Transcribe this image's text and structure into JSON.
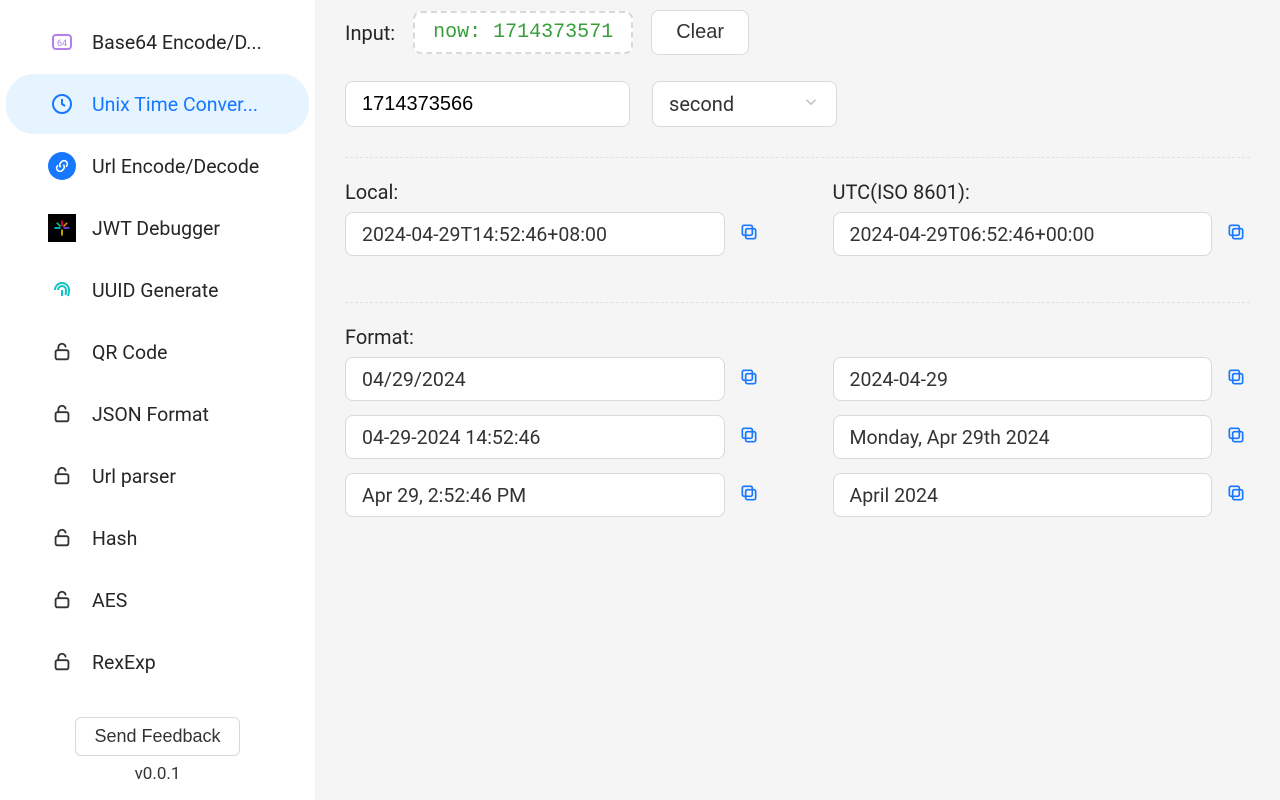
{
  "sidebar": {
    "items": [
      {
        "label": "Base64 Encode/D...",
        "icon": "base64-icon"
      },
      {
        "label": "Unix Time Conver...",
        "icon": "clock-icon"
      },
      {
        "label": "Url Encode/Decode",
        "icon": "link-icon"
      },
      {
        "label": "JWT Debugger",
        "icon": "jwt-icon"
      },
      {
        "label": "UUID Generate",
        "icon": "fingerprint-icon"
      },
      {
        "label": "QR Code",
        "icon": "lock-icon"
      },
      {
        "label": "JSON Format",
        "icon": "lock-icon"
      },
      {
        "label": "Url parser",
        "icon": "lock-icon"
      },
      {
        "label": "Hash",
        "icon": "lock-icon"
      },
      {
        "label": "AES",
        "icon": "lock-icon"
      },
      {
        "label": "RexExp",
        "icon": "lock-icon"
      }
    ]
  },
  "footer": {
    "feedback_label": "Send Feedback",
    "version": "v0.0.1"
  },
  "input": {
    "label": "Input:",
    "now_prefix": "now:",
    "now_value": "1714373571",
    "clear_label": "Clear",
    "timestamp_value": "1714373566",
    "unit_value": "second"
  },
  "local": {
    "label": "Local:",
    "value": "2024-04-29T14:52:46+08:00"
  },
  "utc": {
    "label": "UTC(ISO 8601):",
    "value": "2024-04-29T06:52:46+00:00"
  },
  "format": {
    "label": "Format:",
    "left": [
      "04/29/2024",
      "04-29-2024 14:52:46",
      "Apr 29, 2:52:46 PM"
    ],
    "right": [
      "2024-04-29",
      "Monday, Apr 29th 2024",
      "April 2024"
    ]
  }
}
